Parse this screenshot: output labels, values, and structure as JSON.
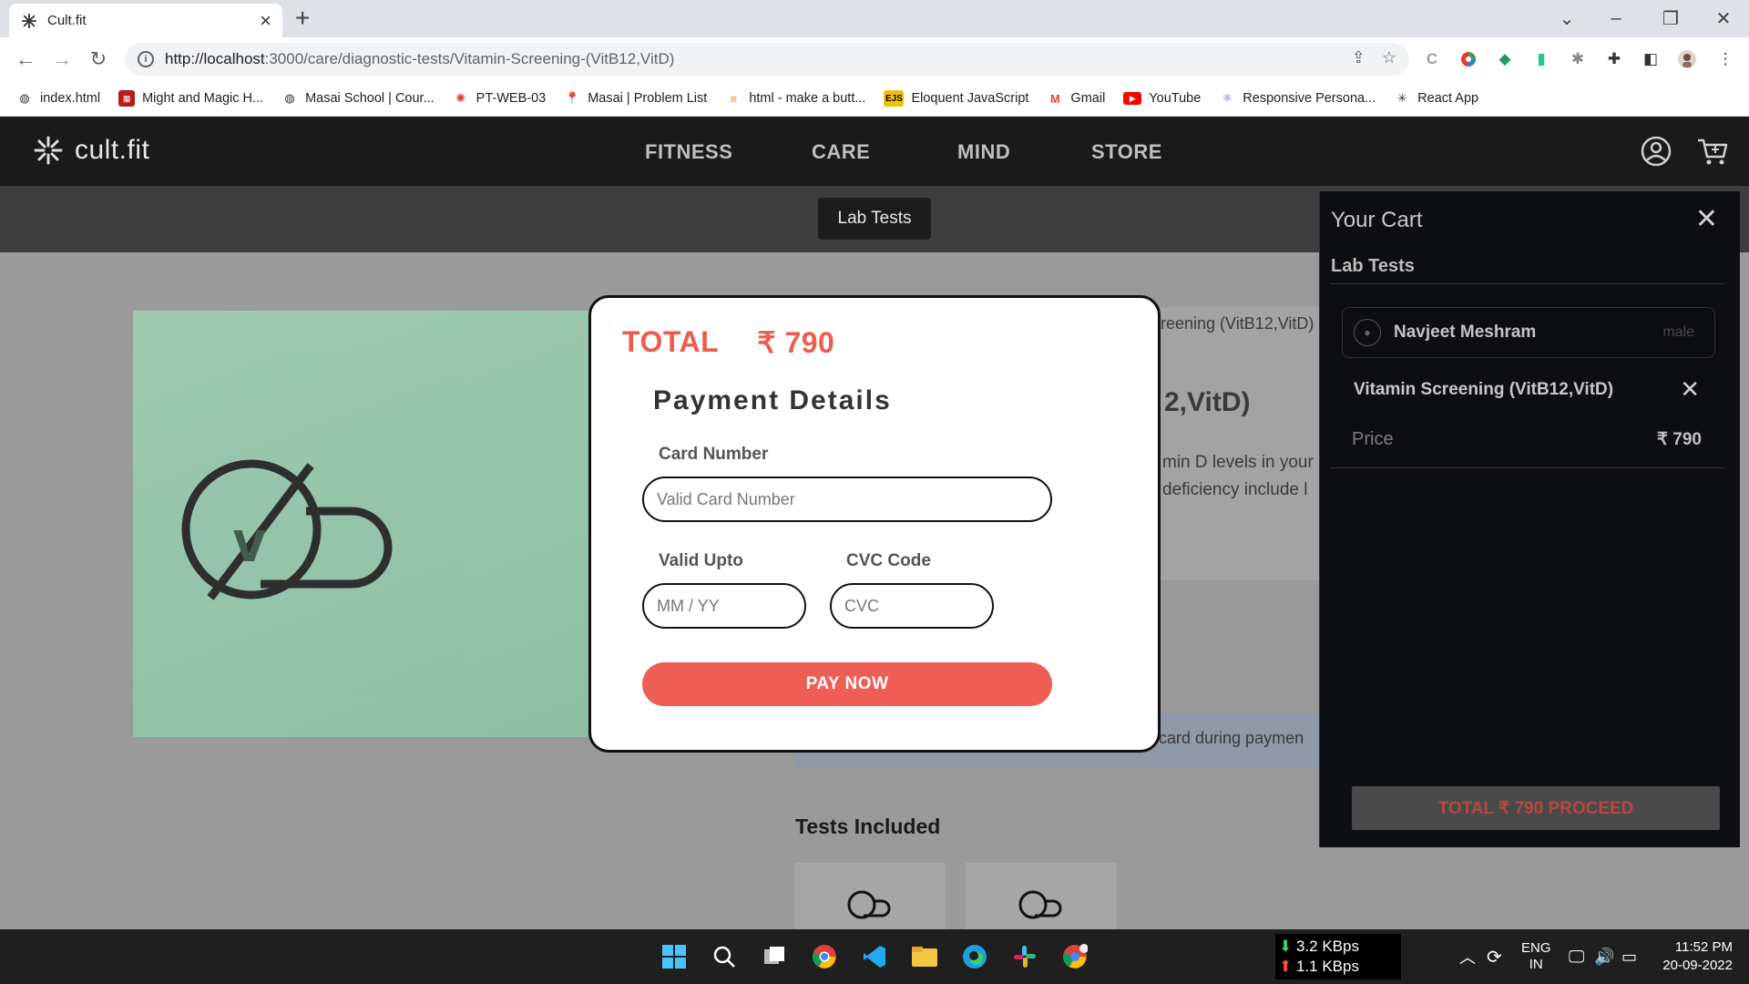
{
  "browser": {
    "tab_title": "Cult.fit",
    "url_host": "http://localhost",
    "url_path": ":3000/care/diagnostic-tests/Vitamin-Screening-(VitB12,VitD)",
    "bookmarks": [
      {
        "label": "index.html",
        "icon": "globe-icon"
      },
      {
        "label": "Might and Magic H...",
        "icon": "game-icon"
      },
      {
        "label": "Masai School | Cour...",
        "icon": "globe-icon"
      },
      {
        "label": "PT-WEB-03",
        "icon": "masai-icon"
      },
      {
        "label": "Masai | Problem List",
        "icon": "pin-icon"
      },
      {
        "label": "html - make a butt...",
        "icon": "stackoverflow-icon"
      },
      {
        "label": "Eloquent JavaScript",
        "icon": "ejs-icon"
      },
      {
        "label": "Gmail",
        "icon": "gmail-icon"
      },
      {
        "label": "YouTube",
        "icon": "youtube-icon"
      },
      {
        "label": "Responsive Persona...",
        "icon": "react-icon"
      },
      {
        "label": "React App",
        "icon": "cultfit-icon"
      }
    ]
  },
  "site": {
    "logo": "cult.fit",
    "nav": [
      "FITNESS",
      "CARE",
      "MIND",
      "STORE"
    ],
    "subnav_pill": "Lab Tests"
  },
  "background": {
    "breadcrumb_fragment": "reening (VitB12,VitD)",
    "title_fragment": "2,VitD)",
    "desc_line1": "min D levels in your",
    "desc_line2": "deficiency include l",
    "band_text": "card during paymen",
    "tests_included": "Tests Included"
  },
  "payment": {
    "total_label": "TOTAL",
    "total_amount": "₹ 790",
    "heading": "Payment Details",
    "card_label": "Card Number",
    "card_placeholder": "Valid Card Number",
    "expiry_label": "Valid Upto",
    "expiry_placeholder": "MM / YY",
    "cvc_label": "CVC Code",
    "cvc_placeholder": "CVC",
    "pay_button": "PAY NOW"
  },
  "cart": {
    "title": "Your Cart",
    "section": "Lab Tests",
    "patient_name": "Navjeet Meshram",
    "patient_gender": "male",
    "item_name": "Vitamin Screening (VitB12,VitD)",
    "price_label": "Price",
    "price_value": "₹ 790",
    "proceed_button": "TOTAL ₹ 790 PROCEED"
  },
  "taskbar": {
    "net_down": "3.2 KBps",
    "net_up": "1.1 KBps",
    "lang_top": "ENG",
    "lang_bottom": "IN",
    "time": "11:52 PM",
    "date": "20-09-2022"
  },
  "colors": {
    "accent": "#ef5b4f",
    "header_bg": "#1a1a1a",
    "cart_bg": "#0d0e11"
  }
}
